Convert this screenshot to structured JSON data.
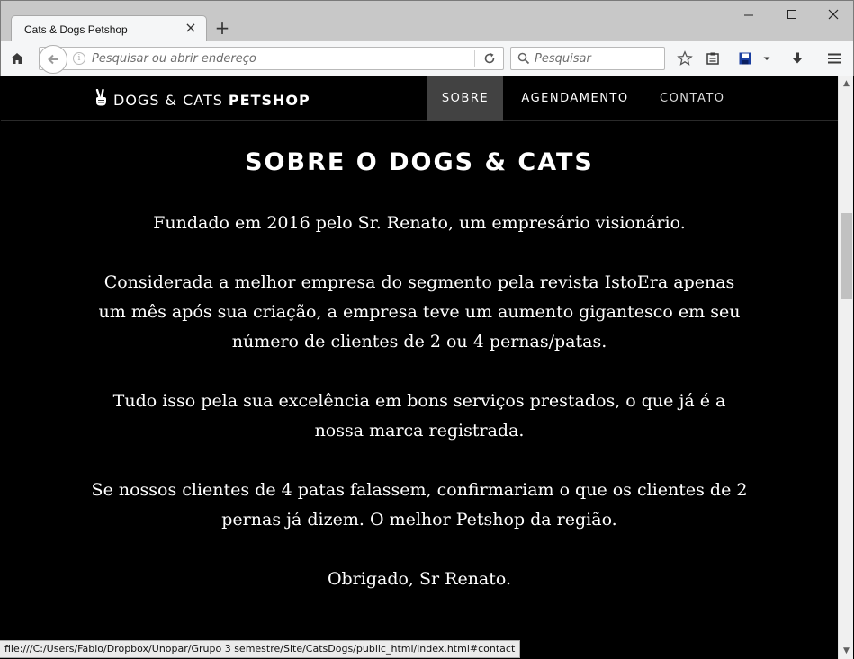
{
  "browser": {
    "tab_title": "Cats & Dogs Petshop",
    "url_placeholder": "Pesquisar ou abrir endereço",
    "search_placeholder": "Pesquisar",
    "status_url": "file:///C:/Users/Fabio/Dropbox/Unopar/Grupo 3 semestre/Site/CatsDogs/public_html/index.html#contact"
  },
  "site": {
    "brand_light": "DOGS & CATS",
    "brand_bold": "PETSHOP",
    "menu": [
      {
        "label": "SOBRE",
        "active": true
      },
      {
        "label": "AGENDAMENTO",
        "active": false
      },
      {
        "label": "CONTATO",
        "active": false
      }
    ]
  },
  "about": {
    "title": "SOBRE O DOGS & CATS",
    "paragraphs": [
      "Fundado em 2016 pelo Sr. Renato, um empresário visionário.",
      "Considerada a melhor empresa do segmento pela revista IstoEra apenas um mês após sua criação, a empresa teve um aumento gigantesco em seu número de clientes de 2 ou 4 pernas/patas.",
      "Tudo isso pela sua excelência em bons serviços prestados, o que já é a nossa marca registrada.",
      "Se nossos clientes de 4 patas falassem, confirmariam o que os clientes de 2 pernas já dizem. O melhor Petshop da região.",
      "Obrigado, Sr Renato."
    ]
  },
  "icons": {
    "brand": "peace-hand-icon",
    "home": "home-icon",
    "back": "back-arrow-icon",
    "reload": "reload-icon",
    "search": "search-icon",
    "bookmark": "star-icon",
    "reading_list": "clipboard-icon",
    "save": "save-icon",
    "download": "download-icon",
    "menu": "hamburger-menu-icon"
  },
  "colors": {
    "page_bg": "#000000",
    "active_menu_bg": "#424242",
    "chrome_bg": "#f5f6f7",
    "titlebar_bg": "#c8c8c8"
  }
}
